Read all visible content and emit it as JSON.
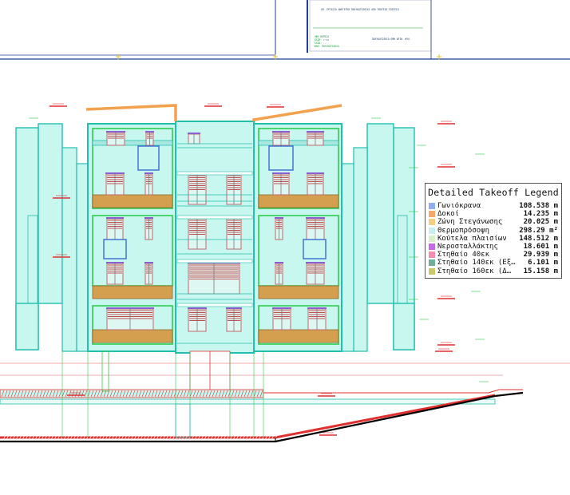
{
  "legend": {
    "title": "Detailed Takeoff Legend",
    "items": [
      {
        "name": "Γωνιόκρανα",
        "value": "108.538 m",
        "color": "#8fb0ef"
      },
      {
        "name": "Δοκοί",
        "value": "14.235 m",
        "color": "#f2a96a"
      },
      {
        "name": "Ζώνη Στεγάνωσης",
        "value": "20.025 m",
        "color": "#f3cf86"
      },
      {
        "name": "Θερμοπρόσοψη",
        "value": "298.29 m²",
        "color": "#c7f0ee"
      },
      {
        "name": "Κούτελα πλαισίων",
        "value": "148.512 m",
        "color": "#d6f0c8"
      },
      {
        "name": "Νεροσταλλάκτης",
        "value": "18.601 m",
        "color": "#c56be6"
      },
      {
        "name": "Στηθαίο 40εκ",
        "value": "29.939 m",
        "color": "#f28fb1"
      },
      {
        "name": "Στηθαίο 140εκ (Εξ…",
        "value": "6.101 m",
        "color": "#6fae9d"
      },
      {
        "name": "Στηθαίο 160εκ (Δ…",
        "value": "15.158 m",
        "color": "#c8c86d"
      }
    ]
  },
  "titleblock": {
    "header_text": "ΑΠ. ΕΡΓΑΣΙΑ ΑΝΕΓΕΡΣΗ ΠΟΛΥΚΑΤΟΙΚΙΑΣ ΑΠΟ ΥΠΟΓΕΙΟ ΙΣΟΓΕΙΟ",
    "lines": [
      "ΟΨΗ ΒΟΡΕΙΑ",
      "ΚΛΙΜ: 1:50",
      "ΣΧΕΔ: ---",
      "ΦΑΚ: ΠΟΛΥΚΑΤΟΙΚΙΑ"
    ],
    "right_text": "ΠΟΛΥΚΑΤΟΙΚΙΑ ΟΨΗ ΑΡΙΘ. ΦΥΛ.",
    "colors": {
      "green": "#1a9a3a",
      "blue": "#224466"
    }
  },
  "drawing": {
    "colors": {
      "facade_fill": "#c8f7ef",
      "facade_stroke": "#22bfae",
      "frame_green": "#2ecc4f",
      "parapet_brown": "#d4a04f",
      "roof_orange": "#f2a24e",
      "dim_red": "#e03030",
      "ground_black": "#000000"
    }
  }
}
